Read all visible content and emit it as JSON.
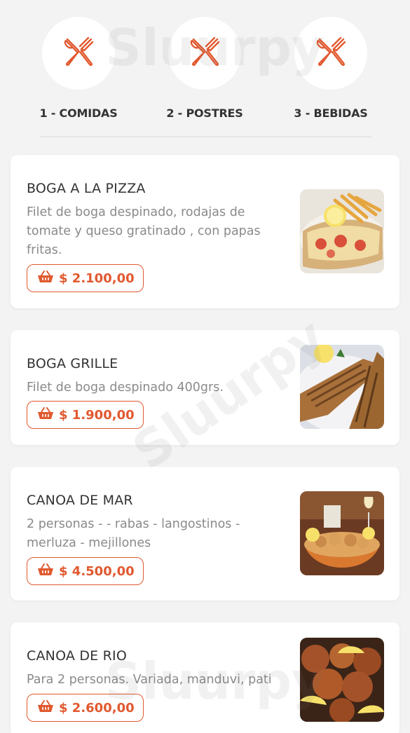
{
  "categories": [
    {
      "label": "1 - COMIDAS",
      "icon": "fork-knife-icon"
    },
    {
      "label": "2 - POSTRES",
      "icon": "fork-knife-icon"
    },
    {
      "label": "3 - BEBIDAS",
      "icon": "fork-knife-icon"
    }
  ],
  "items": [
    {
      "title": "BOGA A LA PIZZA",
      "description": "Filet de boga despinado, rodajas de tomate y queso gratinado , con papas fritas.",
      "price": "$ 2.100,00",
      "image": "fish-pizza-photo"
    },
    {
      "title": "BOGA GRILLE",
      "description": "Filet de boga despinado 400grs.",
      "price": "$ 1.900,00",
      "image": "grilled-fish-photo"
    },
    {
      "title": "CANOA DE MAR",
      "description": "2 personas - - rabas - langostinos - merluza - mejillones",
      "price": "$ 4.500,00",
      "image": "seafood-platter-photo"
    },
    {
      "title": "CANOA DE RIO",
      "description": "Para 2 personas. Variada, manduvi, pati",
      "price": "$ 2.600,00",
      "image": "fried-fish-photo"
    }
  ],
  "watermark": "Sluurpy",
  "colors": {
    "accent": "#e1592f",
    "background": "#f3f3f3",
    "card": "#ffffff"
  }
}
